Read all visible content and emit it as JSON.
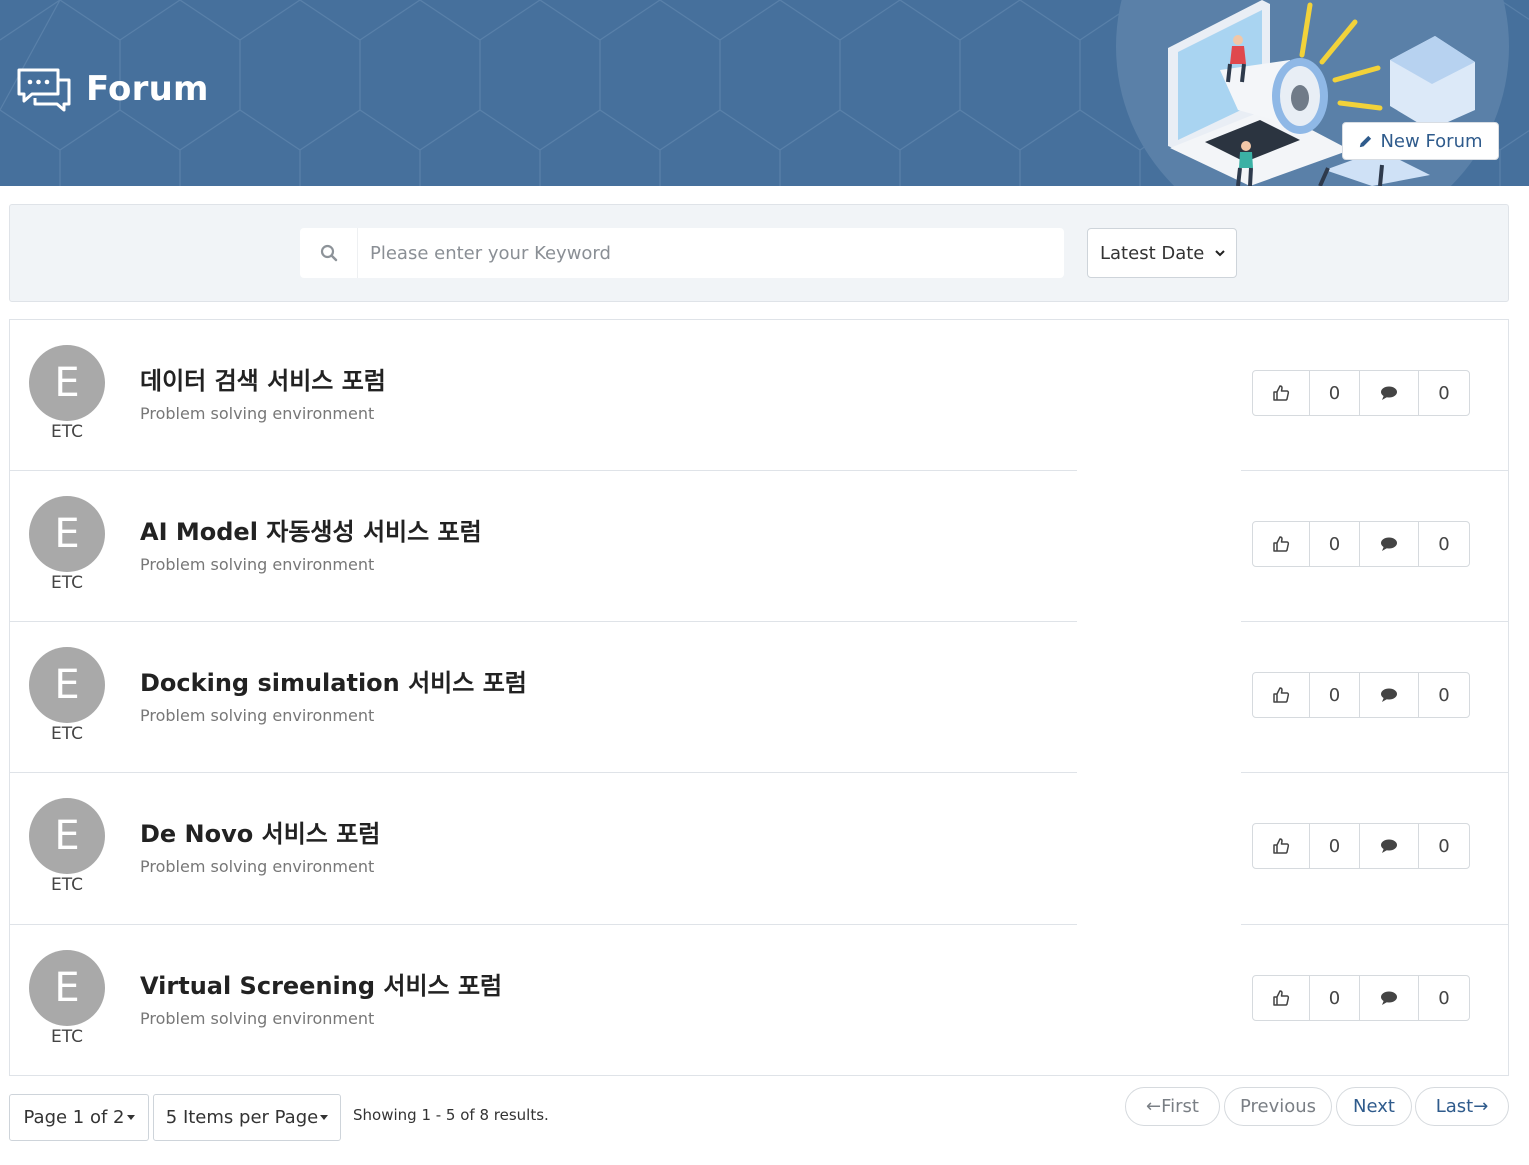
{
  "header": {
    "title": "Forum",
    "icon": "chat-bubbles-icon",
    "new_forum_label": "New Forum",
    "new_forum_icon": "pencil-icon",
    "background_color": "#46709c"
  },
  "search": {
    "placeholder": "Please enter your Keyword",
    "value": "",
    "icon": "search-icon",
    "sort_selected": "Latest Date"
  },
  "forums": [
    {
      "avatar_letter": "E",
      "category": "ETC",
      "title": "데이터 검색 서비스 포럼",
      "subtitle": "Problem solving environment",
      "likes": "0",
      "comments": "0"
    },
    {
      "avatar_letter": "E",
      "category": "ETC",
      "title": "AI Model 자동생성 서비스 포럼",
      "subtitle": "Problem solving environment",
      "likes": "0",
      "comments": "0"
    },
    {
      "avatar_letter": "E",
      "category": "ETC",
      "title": "Docking simulation 서비스 포럼",
      "subtitle": "Problem solving environment",
      "likes": "0",
      "comments": "0"
    },
    {
      "avatar_letter": "E",
      "category": "ETC",
      "title": "De Novo 서비스 포럼",
      "subtitle": "Problem solving environment",
      "likes": "0",
      "comments": "0"
    },
    {
      "avatar_letter": "E",
      "category": "ETC",
      "title": "Virtual Screening 서비스 포럼",
      "subtitle": "Problem solving environment",
      "likes": "0",
      "comments": "0"
    }
  ],
  "pagination": {
    "page_label": "Page 1 of 2",
    "per_page_label": "5 Items per Page",
    "showing": "Showing 1 - 5 of 8 results.",
    "first": "First",
    "previous": "Previous",
    "next": "Next",
    "last": "Last"
  },
  "colors": {
    "accent": "#2f5b8c",
    "avatar": "#a9a9a9"
  }
}
